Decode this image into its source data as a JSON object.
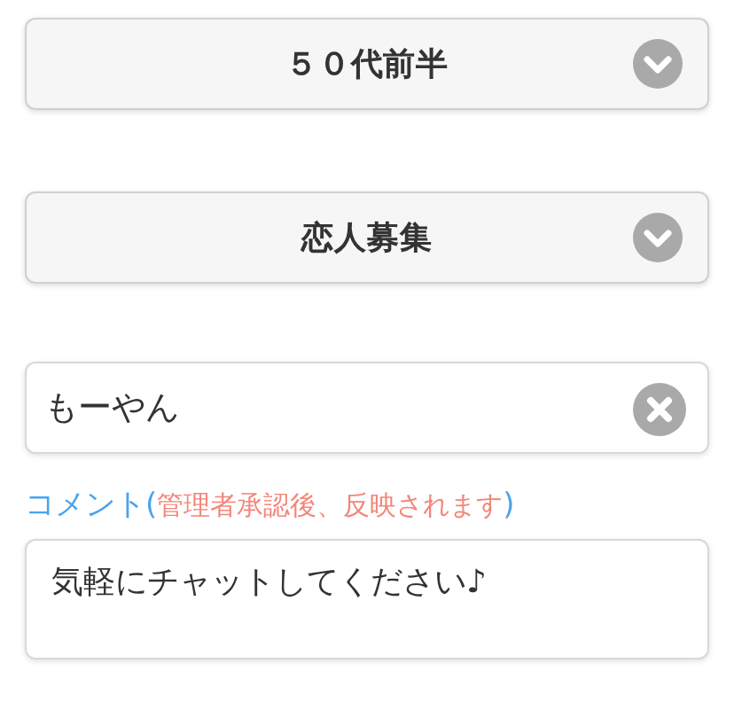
{
  "selects": [
    {
      "value": "５０代前半"
    },
    {
      "value": "恋人募集"
    }
  ],
  "name_field": {
    "value": "もーやん"
  },
  "comment": {
    "label": "コメント(",
    "note": "管理者承認後、反映されます",
    "label_end": ")",
    "value": "気軽にチャットしてください♪"
  }
}
